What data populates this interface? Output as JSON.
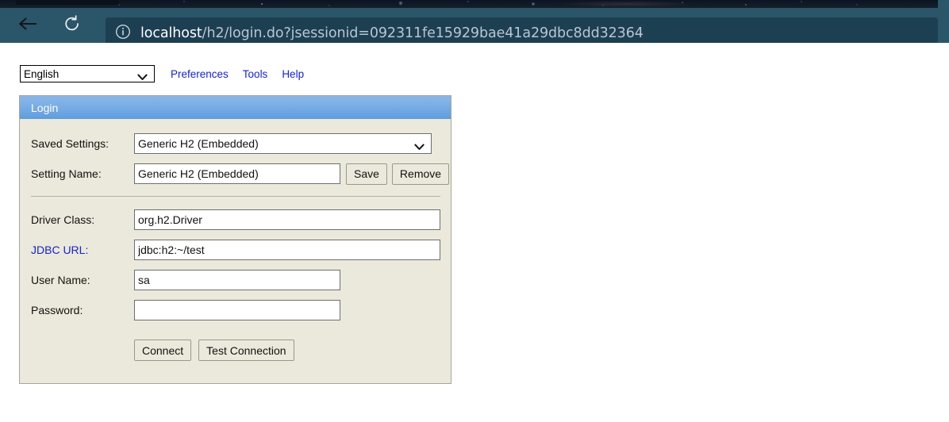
{
  "browser": {
    "back_icon": "back-arrow-icon",
    "reload_icon": "reload-icon",
    "info_icon": "info-circle-icon",
    "url_host": "localhost",
    "url_path": "/h2/login.do?jsessionid=092311fe15929bae41a29dbc8dd32364",
    "toolbar_color": "#2b5568",
    "urlbar_color": "#1d3f52"
  },
  "toolbar": {
    "language_selected": "English",
    "language_options": [
      "English"
    ],
    "links": [
      {
        "label": "Preferences",
        "name": "preferences-link"
      },
      {
        "label": "Tools",
        "name": "tools-link"
      },
      {
        "label": "Help",
        "name": "help-link"
      }
    ],
    "link_color": "#1622d4"
  },
  "login_panel": {
    "title": "Login",
    "header_color": "#7db0e6",
    "body_color": "#ebe9db",
    "saved_settings": {
      "label": "Saved Settings:",
      "selected": "Generic H2 (Embedded)",
      "options": [
        "Generic H2 (Embedded)"
      ]
    },
    "setting_name": {
      "label": "Setting Name:",
      "value": "Generic H2 (Embedded)",
      "save_button": "Save",
      "remove_button": "Remove"
    },
    "driver_class": {
      "label": "Driver Class:",
      "value": "org.h2.Driver"
    },
    "jdbc_url": {
      "label": "JDBC URL:",
      "value": "jdbc:h2:~/test",
      "is_link": true
    },
    "user_name": {
      "label": "User Name:",
      "value": "sa"
    },
    "password": {
      "label": "Password:",
      "value": "",
      "placeholder": ""
    },
    "actions": {
      "connect_button": "Connect",
      "test_connection_button": "Test Connection"
    }
  }
}
